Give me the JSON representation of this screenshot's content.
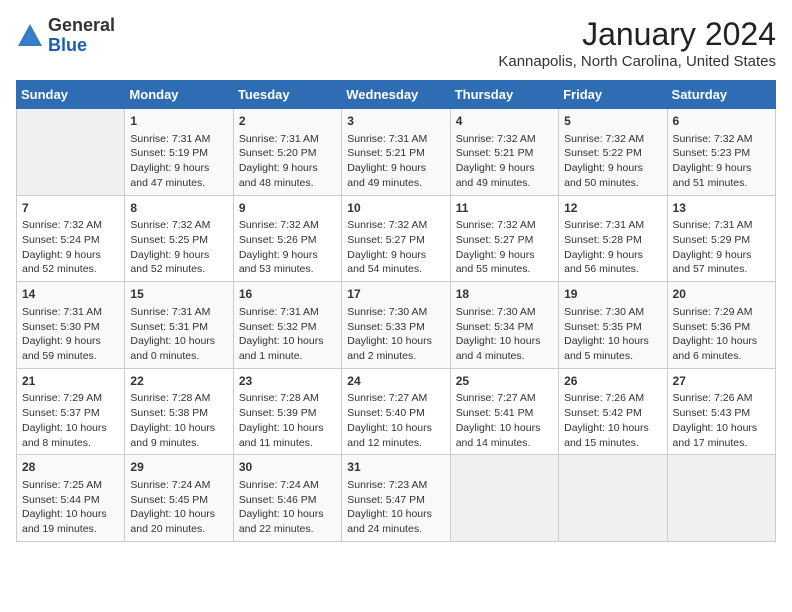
{
  "header": {
    "logo_general": "General",
    "logo_blue": "Blue",
    "month_title": "January 2024",
    "location": "Kannapolis, North Carolina, United States"
  },
  "weekdays": [
    "Sunday",
    "Monday",
    "Tuesday",
    "Wednesday",
    "Thursday",
    "Friday",
    "Saturday"
  ],
  "weeks": [
    [
      {
        "day": "",
        "sunrise": "",
        "sunset": "",
        "daylight": ""
      },
      {
        "day": "1",
        "sunrise": "Sunrise: 7:31 AM",
        "sunset": "Sunset: 5:19 PM",
        "daylight": "Daylight: 9 hours and 47 minutes."
      },
      {
        "day": "2",
        "sunrise": "Sunrise: 7:31 AM",
        "sunset": "Sunset: 5:20 PM",
        "daylight": "Daylight: 9 hours and 48 minutes."
      },
      {
        "day": "3",
        "sunrise": "Sunrise: 7:31 AM",
        "sunset": "Sunset: 5:21 PM",
        "daylight": "Daylight: 9 hours and 49 minutes."
      },
      {
        "day": "4",
        "sunrise": "Sunrise: 7:32 AM",
        "sunset": "Sunset: 5:21 PM",
        "daylight": "Daylight: 9 hours and 49 minutes."
      },
      {
        "day": "5",
        "sunrise": "Sunrise: 7:32 AM",
        "sunset": "Sunset: 5:22 PM",
        "daylight": "Daylight: 9 hours and 50 minutes."
      },
      {
        "day": "6",
        "sunrise": "Sunrise: 7:32 AM",
        "sunset": "Sunset: 5:23 PM",
        "daylight": "Daylight: 9 hours and 51 minutes."
      }
    ],
    [
      {
        "day": "7",
        "sunrise": "Sunrise: 7:32 AM",
        "sunset": "Sunset: 5:24 PM",
        "daylight": "Daylight: 9 hours and 52 minutes."
      },
      {
        "day": "8",
        "sunrise": "Sunrise: 7:32 AM",
        "sunset": "Sunset: 5:25 PM",
        "daylight": "Daylight: 9 hours and 52 minutes."
      },
      {
        "day": "9",
        "sunrise": "Sunrise: 7:32 AM",
        "sunset": "Sunset: 5:26 PM",
        "daylight": "Daylight: 9 hours and 53 minutes."
      },
      {
        "day": "10",
        "sunrise": "Sunrise: 7:32 AM",
        "sunset": "Sunset: 5:27 PM",
        "daylight": "Daylight: 9 hours and 54 minutes."
      },
      {
        "day": "11",
        "sunrise": "Sunrise: 7:32 AM",
        "sunset": "Sunset: 5:27 PM",
        "daylight": "Daylight: 9 hours and 55 minutes."
      },
      {
        "day": "12",
        "sunrise": "Sunrise: 7:31 AM",
        "sunset": "Sunset: 5:28 PM",
        "daylight": "Daylight: 9 hours and 56 minutes."
      },
      {
        "day": "13",
        "sunrise": "Sunrise: 7:31 AM",
        "sunset": "Sunset: 5:29 PM",
        "daylight": "Daylight: 9 hours and 57 minutes."
      }
    ],
    [
      {
        "day": "14",
        "sunrise": "Sunrise: 7:31 AM",
        "sunset": "Sunset: 5:30 PM",
        "daylight": "Daylight: 9 hours and 59 minutes."
      },
      {
        "day": "15",
        "sunrise": "Sunrise: 7:31 AM",
        "sunset": "Sunset: 5:31 PM",
        "daylight": "Daylight: 10 hours and 0 minutes."
      },
      {
        "day": "16",
        "sunrise": "Sunrise: 7:31 AM",
        "sunset": "Sunset: 5:32 PM",
        "daylight": "Daylight: 10 hours and 1 minute."
      },
      {
        "day": "17",
        "sunrise": "Sunrise: 7:30 AM",
        "sunset": "Sunset: 5:33 PM",
        "daylight": "Daylight: 10 hours and 2 minutes."
      },
      {
        "day": "18",
        "sunrise": "Sunrise: 7:30 AM",
        "sunset": "Sunset: 5:34 PM",
        "daylight": "Daylight: 10 hours and 4 minutes."
      },
      {
        "day": "19",
        "sunrise": "Sunrise: 7:30 AM",
        "sunset": "Sunset: 5:35 PM",
        "daylight": "Daylight: 10 hours and 5 minutes."
      },
      {
        "day": "20",
        "sunrise": "Sunrise: 7:29 AM",
        "sunset": "Sunset: 5:36 PM",
        "daylight": "Daylight: 10 hours and 6 minutes."
      }
    ],
    [
      {
        "day": "21",
        "sunrise": "Sunrise: 7:29 AM",
        "sunset": "Sunset: 5:37 PM",
        "daylight": "Daylight: 10 hours and 8 minutes."
      },
      {
        "day": "22",
        "sunrise": "Sunrise: 7:28 AM",
        "sunset": "Sunset: 5:38 PM",
        "daylight": "Daylight: 10 hours and 9 minutes."
      },
      {
        "day": "23",
        "sunrise": "Sunrise: 7:28 AM",
        "sunset": "Sunset: 5:39 PM",
        "daylight": "Daylight: 10 hours and 11 minutes."
      },
      {
        "day": "24",
        "sunrise": "Sunrise: 7:27 AM",
        "sunset": "Sunset: 5:40 PM",
        "daylight": "Daylight: 10 hours and 12 minutes."
      },
      {
        "day": "25",
        "sunrise": "Sunrise: 7:27 AM",
        "sunset": "Sunset: 5:41 PM",
        "daylight": "Daylight: 10 hours and 14 minutes."
      },
      {
        "day": "26",
        "sunrise": "Sunrise: 7:26 AM",
        "sunset": "Sunset: 5:42 PM",
        "daylight": "Daylight: 10 hours and 15 minutes."
      },
      {
        "day": "27",
        "sunrise": "Sunrise: 7:26 AM",
        "sunset": "Sunset: 5:43 PM",
        "daylight": "Daylight: 10 hours and 17 minutes."
      }
    ],
    [
      {
        "day": "28",
        "sunrise": "Sunrise: 7:25 AM",
        "sunset": "Sunset: 5:44 PM",
        "daylight": "Daylight: 10 hours and 19 minutes."
      },
      {
        "day": "29",
        "sunrise": "Sunrise: 7:24 AM",
        "sunset": "Sunset: 5:45 PM",
        "daylight": "Daylight: 10 hours and 20 minutes."
      },
      {
        "day": "30",
        "sunrise": "Sunrise: 7:24 AM",
        "sunset": "Sunset: 5:46 PM",
        "daylight": "Daylight: 10 hours and 22 minutes."
      },
      {
        "day": "31",
        "sunrise": "Sunrise: 7:23 AM",
        "sunset": "Sunset: 5:47 PM",
        "daylight": "Daylight: 10 hours and 24 minutes."
      },
      {
        "day": "",
        "sunrise": "",
        "sunset": "",
        "daylight": ""
      },
      {
        "day": "",
        "sunrise": "",
        "sunset": "",
        "daylight": ""
      },
      {
        "day": "",
        "sunrise": "",
        "sunset": "",
        "daylight": ""
      }
    ]
  ]
}
